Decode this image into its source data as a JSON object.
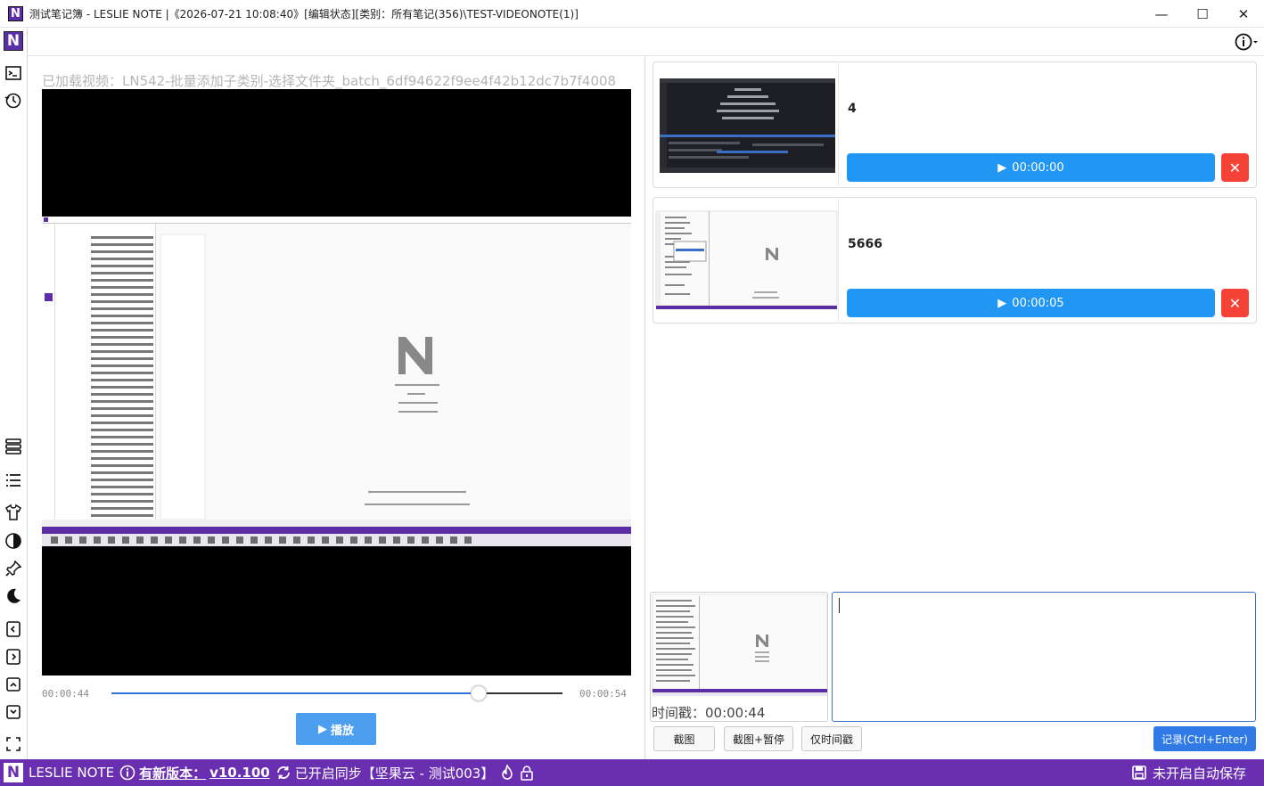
{
  "window": {
    "app_initial": "N",
    "title": "测试笔记簿 - LESLIE NOTE |《2026-07-21 10:08:40》[编辑状态][类别：所有笔记(356)\\TEST-VIDEONOTE(1)]",
    "minimize": "—",
    "maximize": "☐",
    "close": "✕"
  },
  "sidebar": {
    "logo": "N",
    "icons": [
      "terminal-icon",
      "history-icon",
      "layout-icon",
      "list-icon",
      "tshirt-theme-icon",
      "contrast-icon",
      "pin-icon",
      "moon-icon",
      "collapse-left-icon",
      "collapse-right-icon",
      "toggle-top-icon",
      "toggle-bottom-icon",
      "fullscreen-icon"
    ]
  },
  "video": {
    "loaded_label": "已加载视频：LN542-批量添加子类别-选择文件夹_batch_6df94622f9ee4f42b12dc7b7f4008",
    "current_time": "00:00:44",
    "total_time": "00:00:54",
    "progress_fraction": 0.815,
    "play_label": "播放",
    "play_icon": "▶"
  },
  "notes": [
    {
      "text": "4",
      "timestamp": "00:00:00",
      "delete_icon": "✕"
    },
    {
      "text": "5666",
      "timestamp": "00:00:05",
      "delete_icon": "✕"
    }
  ],
  "capture": {
    "timestamp_label": "时间戳：00:00:44",
    "input_value": ""
  },
  "actions": {
    "screenshot": "截图",
    "screenshot_pause": "截图+暂停",
    "timestamp_only": "仅时间戳",
    "record": "记录(Ctrl+Enter)"
  },
  "status": {
    "logo": "N",
    "app_name": "LESLIE NOTE",
    "new_version_label": "有新版本：",
    "new_version": "v10.100",
    "sync_text": "已开启同步【坚果云 - 测试003】",
    "autosave_text": "未开启自动保存"
  },
  "colors": {
    "brand": "#6a2fb0",
    "accent": "#2196f3",
    "danger": "#f44336",
    "play": "#4c9ff0"
  }
}
